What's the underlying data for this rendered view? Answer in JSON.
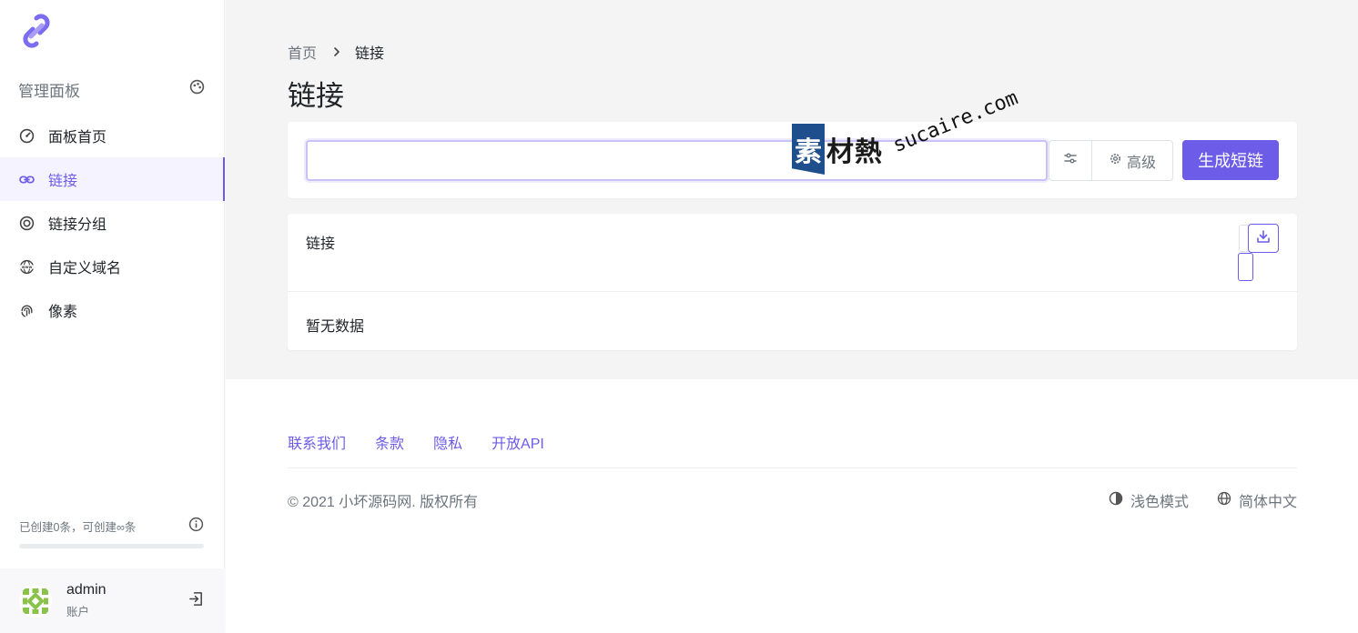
{
  "sidebar": {
    "panel_title": "管理面板",
    "items": [
      {
        "label": "面板首页",
        "icon": "speedometer-icon"
      },
      {
        "label": "链接",
        "icon": "link-icon"
      },
      {
        "label": "链接分组",
        "icon": "target-icon"
      },
      {
        "label": "自定义域名",
        "icon": "www-globe-icon"
      },
      {
        "label": "像素",
        "icon": "fingerprint-icon"
      }
    ],
    "quota_text": "已创建0条，可创建∞条",
    "quota_fill": 0,
    "user": {
      "name": "admin",
      "role": "账户"
    }
  },
  "header": {
    "breadcrumb_home": "首页",
    "breadcrumb_current": "链接",
    "title": "链接"
  },
  "form": {
    "url_value": "",
    "advanced_label": "高级",
    "submit_label": "生成短链"
  },
  "list": {
    "title": "链接",
    "empty_text": "暂无数据"
  },
  "footer": {
    "links": [
      "联系我们",
      "条款",
      "隐私",
      "开放API"
    ],
    "copyright": "© 2021 小坏源码网. 版权所有",
    "theme_label": "浅色模式",
    "language_label": "简体中文"
  },
  "watermark": {
    "badge": "素",
    "text": "材熱",
    "domain": "sucaire.com"
  },
  "colors": {
    "accent": "#6c5ce7",
    "page_bg": "#f4f4f4",
    "muted_text": "#6c757d"
  }
}
